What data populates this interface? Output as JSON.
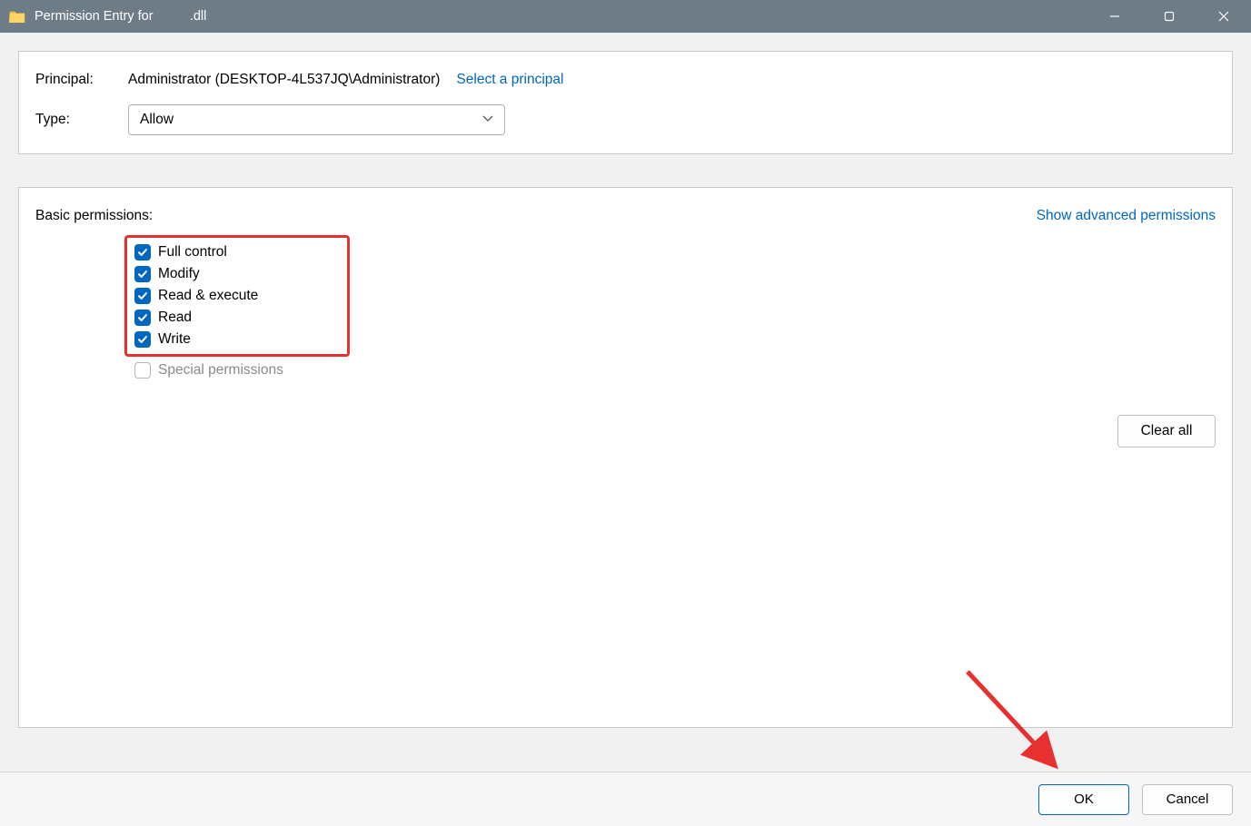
{
  "titlebar": {
    "title": "Permission Entry for          .dll"
  },
  "top": {
    "principal_label": "Principal:",
    "principal_value": "Administrator (DESKTOP-4L537JQ\\Administrator)",
    "select_principal_link": "Select a principal",
    "type_label": "Type:",
    "type_value": "Allow"
  },
  "permissions": {
    "title": "Basic permissions:",
    "advanced_link": "Show advanced permissions",
    "items": [
      {
        "label": "Full control",
        "checked": true
      },
      {
        "label": "Modify",
        "checked": true
      },
      {
        "label": "Read & execute",
        "checked": true
      },
      {
        "label": "Read",
        "checked": true
      },
      {
        "label": "Write",
        "checked": true
      }
    ],
    "special_label": "Special permissions",
    "clear_all": "Clear all"
  },
  "footer": {
    "ok": "OK",
    "cancel": "Cancel"
  }
}
